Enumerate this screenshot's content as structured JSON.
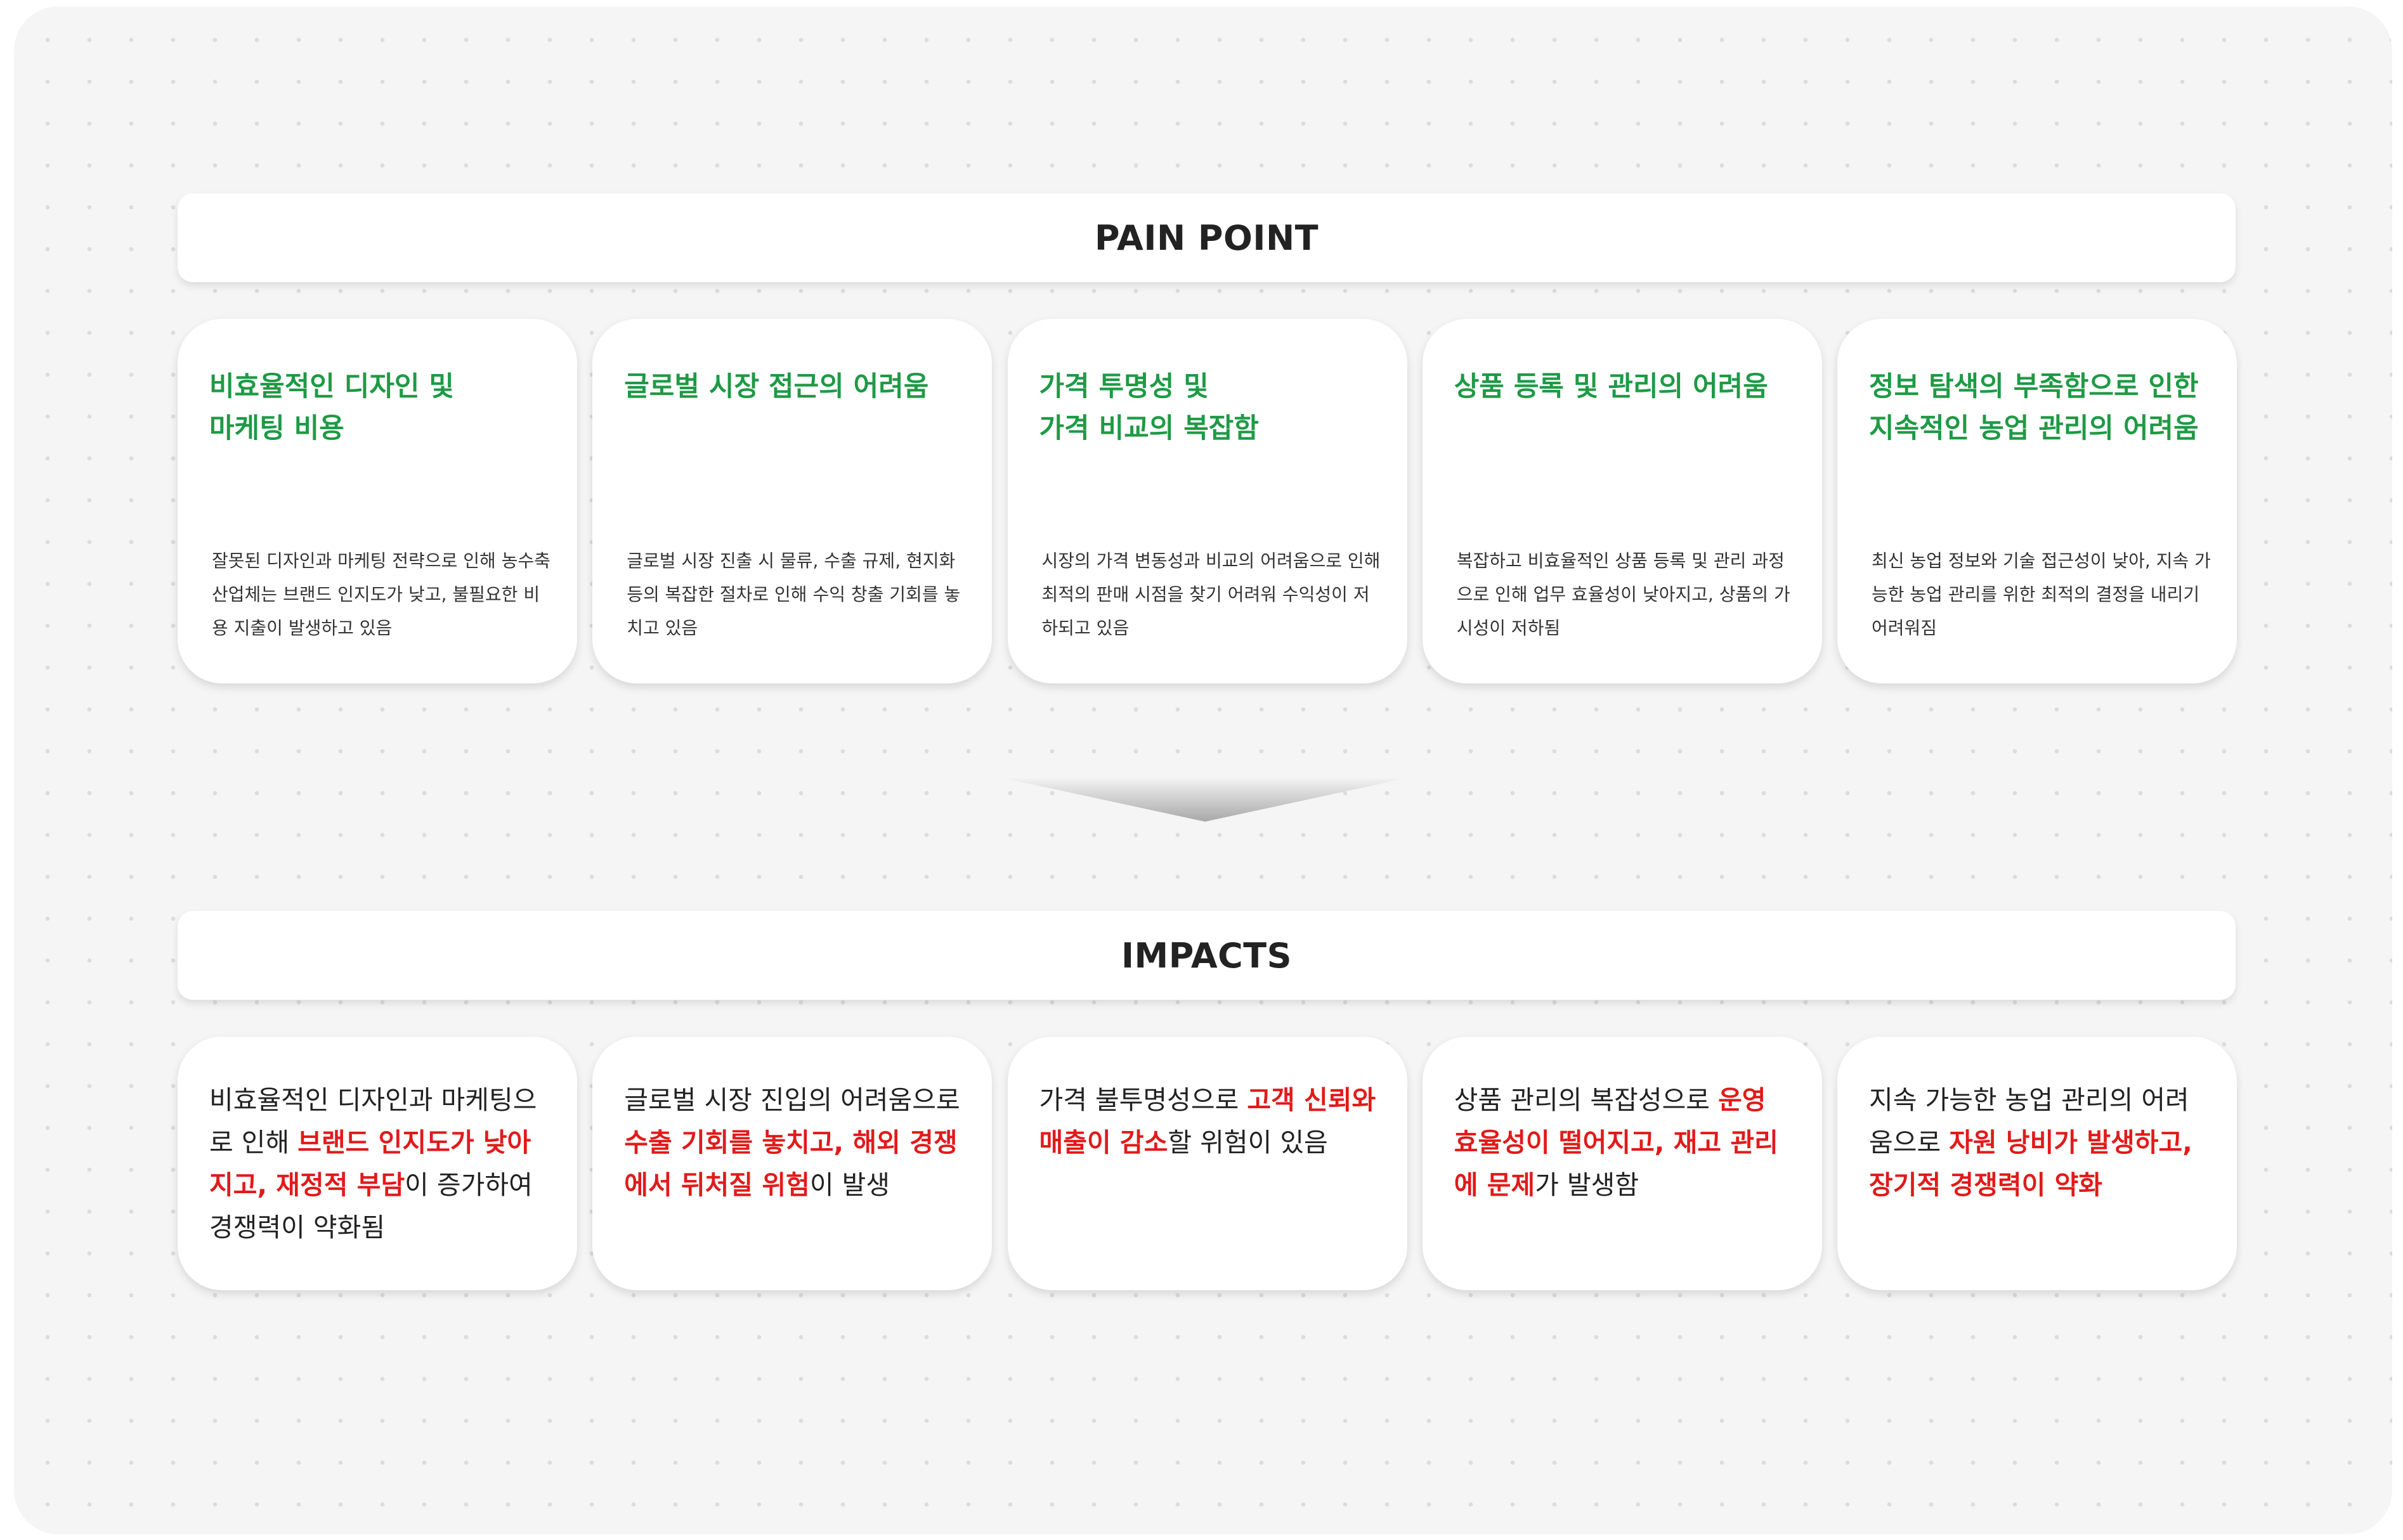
{
  "pain_point": {
    "heading": "PAIN POINT",
    "items": [
      {
        "title": "비효율적인 디자인 및\n마케팅 비용",
        "description": "잘못된 디자인과 마케팅 전략으로 인해 농수축 산업체는 브랜드 인지도가 낮고, 불필요한 비용 지출이 발생하고 있음"
      },
      {
        "title": "글로벌 시장 접근의 어려움",
        "description": "글로벌 시장 진출 시 물류, 수출 규제, 현지화 등의 복잡한 절차로 인해 수익 창출 기회를 놓치고 있음"
      },
      {
        "title": "가격 투명성 및\n가격 비교의 복잡함",
        "description": "시장의 가격 변동성과 비교의 어려움으로 인해 최적의 판매 시점을 찾기 어려워 수익성이 저하되고 있음"
      },
      {
        "title": "상품 등록 및 관리의 어려움",
        "description": "복잡하고 비효율적인 상품 등록 및 관리 과정으로 인해 업무 효율성이 낮아지고, 상품의 가시성이 저하됨"
      },
      {
        "title": "정보 탐색의 부족함으로 인한\n지속적인 농업 관리의 어려움",
        "description": "최신 농업 정보와 기술 접근성이 낮아, 지속 가능한 농업 관리를 위한 최적의 결정을 내리기 어려워짐"
      }
    ]
  },
  "impacts": {
    "heading": "IMPACTS",
    "items": [
      {
        "before": "비효율적인 디자인과 마케팅으로 인해 ",
        "highlight": "브랜드 인지도가 낮아지고, 재정적 부담",
        "after": "이 증가하여 경쟁력이 약화됨"
      },
      {
        "before": "글로벌 시장 진입의 어려움으로 ",
        "highlight": "수출 기회를 놓치고, 해외 경쟁에서 뒤처질 위험",
        "after": "이 발생"
      },
      {
        "before": "가격 불투명성으로 ",
        "highlight": "고객 신뢰와 매출이 감소",
        "after": "할 위험이 있음"
      },
      {
        "before": "상품 관리의 복잡성으로 ",
        "highlight": "운영 효율성이 떨어지고, 재고 관리에 문제",
        "after": "가 발생함"
      },
      {
        "before": "지속 가능한 농업 관리의 어려움으로 ",
        "highlight": "자원 낭비가 발생하고, 장기적 경쟁력이 약화",
        "after": ""
      }
    ]
  },
  "colors": {
    "pain_title": "#1e9a45",
    "impact_highlight": "#e21a1a",
    "heading_text": "#222222",
    "background": "#f5f5f5"
  },
  "icons": {
    "flow_arrow": "down-arrow-icon"
  }
}
